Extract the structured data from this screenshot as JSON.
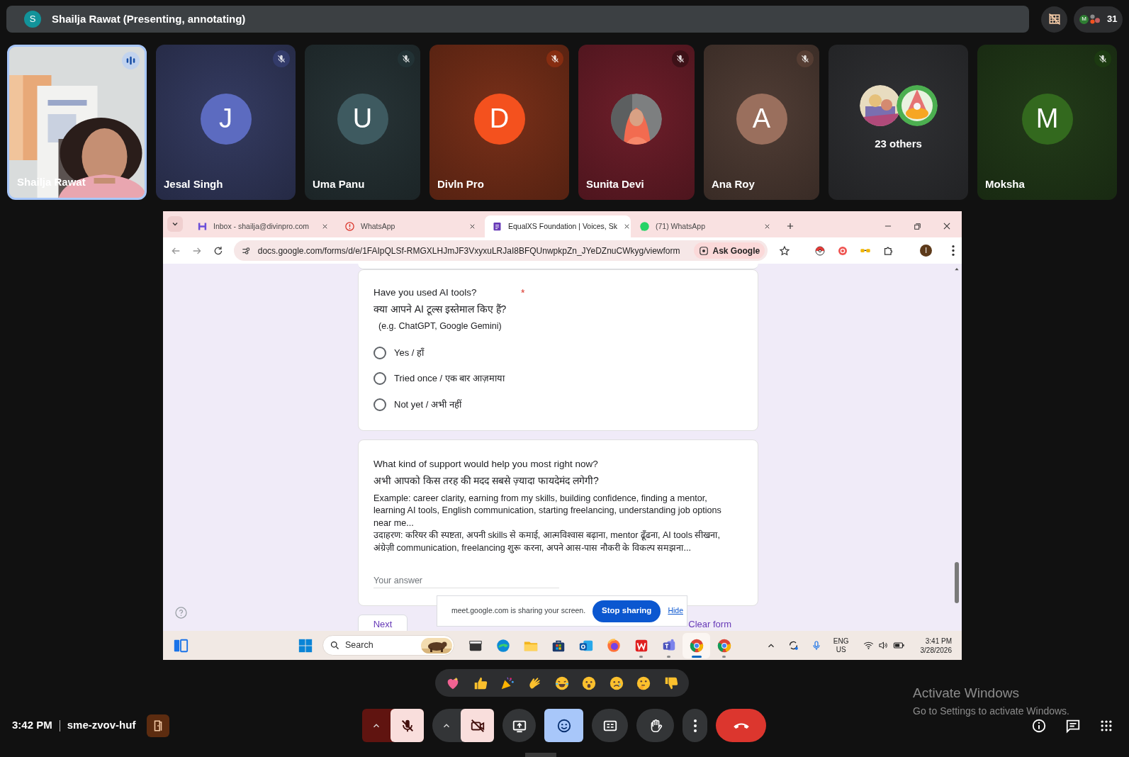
{
  "top_bar": {
    "presenter_initial": "S",
    "title": "Shailja Rawat (Presenting, annotating)",
    "participant_badge_initial": "M",
    "participant_count": "31"
  },
  "participants": [
    {
      "name": "Shailja Rawat",
      "kind": "video",
      "muted": false,
      "speaking": true
    },
    {
      "name": "Jesal Singh",
      "kind": "initial",
      "initial": "J",
      "color": "#5c6bc0",
      "muted": true,
      "speaking": false
    },
    {
      "name": "Uma Panu",
      "kind": "initial",
      "initial": "U",
      "color": "#3e5a60",
      "muted": true,
      "speaking": false
    },
    {
      "name": "Divln Pro",
      "kind": "initial",
      "initial": "D",
      "color": "#f4511e",
      "muted": true,
      "speaking": false
    },
    {
      "name": "Sunita Devi",
      "color": "#6e1e2a",
      "muted": true,
      "speaking": false
    },
    {
      "name": "Ana Roy",
      "kind": "initial",
      "initial": "A",
      "color": "#9a6f5d",
      "muted": true,
      "speaking": false
    },
    {
      "name": "23 others",
      "kind": "group",
      "muted": false,
      "speaking": false
    },
    {
      "name": "Moksha",
      "kind": "initial",
      "initial": "M",
      "color": "#33691e",
      "muted": true,
      "speaking": false
    }
  ],
  "browser": {
    "tabs": [
      {
        "title": "Inbox - shailja@divinpro.com",
        "kind": "mail",
        "selected": false
      },
      {
        "title": "WhatsApp",
        "kind": "alert",
        "selected": false
      },
      {
        "title": "EqualXS Foundation | Voices, Sk",
        "kind": "forms",
        "selected": true
      },
      {
        "title": "(71) WhatsApp",
        "kind": "whatsapp",
        "selected": false
      }
    ],
    "url": "docs.google.com/forms/d/e/1FAIpQLSf-RMGXLHJmJF3VxyxuLRJaI8BFQUnwpkpZn_JYeDZnuCWkyg/viewform",
    "ask_google": "Ask Google",
    "profile_initial": "I"
  },
  "form": {
    "questions": [
      {
        "kind": "radio",
        "title": "Have you used AI tools?",
        "title_hindi": "क्या आपने AI टूल्स इस्तेमाल किए हैं?",
        "hint": "(e.g. ChatGPT, Google Gemini)",
        "required_mark": "*",
        "options": [
          {
            "label": "Yes / हाँ",
            "selected": false
          },
          {
            "label": "Tried once / एक बार आज़माया",
            "selected": false
          },
          {
            "label": "Not yet / अभी नहीं",
            "selected": false
          }
        ]
      },
      {
        "kind": "text",
        "title": "What kind of support would help you most right now?",
        "title_hindi": "अभी आपको किस तरह की मदद सबसे ज़्यादा फायदेमंद लगेगी?",
        "description": [
          "Example: career clarity, earning from my skills, building confidence, finding a mentor, learning AI tools, English communication, starting freelancing, understanding job options near me...",
          "उदाहरण: करियर की स्पष्टता, अपनी skills से कमाई, आत्मविश्वास बढ़ाना, mentor ढूँढना, AI tools सीखना, अंग्रेज़ी communication, freelancing शुरू करना, अपने आस-पास नौकरी के विकल्प समझना..."
        ],
        "placeholder": "Your answer"
      }
    ],
    "next_button": "Next",
    "clear_form": "Clear form"
  },
  "sharing_bar": {
    "message": "meet.google.com is sharing your screen.",
    "stop_button": "Stop sharing",
    "hide_link": "Hide"
  },
  "taskbar": {
    "search": {
      "placeholder": "Search"
    },
    "apps": [
      {
        "kind": "terminal",
        "active": false,
        "running": false
      },
      {
        "kind": "edge",
        "active": false,
        "running": false
      },
      {
        "kind": "folder",
        "active": false,
        "running": false
      },
      {
        "kind": "store",
        "active": false,
        "running": false
      },
      {
        "kind": "outlook",
        "active": false,
        "running": false
      },
      {
        "kind": "firefox",
        "active": false,
        "running": false
      },
      {
        "kind": "wps",
        "active": false,
        "running": true
      },
      {
        "kind": "teams",
        "active": false,
        "running": true
      },
      {
        "kind": "chrome",
        "active": true,
        "running": true
      },
      {
        "kind": "chrome",
        "active": false,
        "running": true
      }
    ],
    "language": "ENG",
    "region": "US",
    "time": "3:41 PM",
    "date": "3/28/2026"
  },
  "reactions": [
    {
      "kind": "heart"
    },
    {
      "kind": "thumbs-up"
    },
    {
      "kind": "party"
    },
    {
      "kind": "clap"
    },
    {
      "kind": "laugh"
    },
    {
      "kind": "surprised"
    },
    {
      "kind": "sad"
    },
    {
      "kind": "thinking"
    },
    {
      "kind": "thumbs-down"
    }
  ],
  "meeting": {
    "time": "3:42 PM",
    "code": "sme-zvov-huf"
  },
  "controls": [
    {
      "kind": "mic",
      "muted": true
    },
    {
      "kind": "camera",
      "muted": true
    },
    {
      "kind": "present"
    },
    {
      "kind": "reactions",
      "selected": true
    },
    {
      "kind": "captions",
      "selected": false
    },
    {
      "kind": "hand",
      "selected": false
    },
    {
      "kind": "more",
      "selected": false
    },
    {
      "kind": "end-call"
    }
  ],
  "system_notice": {
    "title": "Activate Windows",
    "message": "Go to Settings to activate Windows."
  }
}
